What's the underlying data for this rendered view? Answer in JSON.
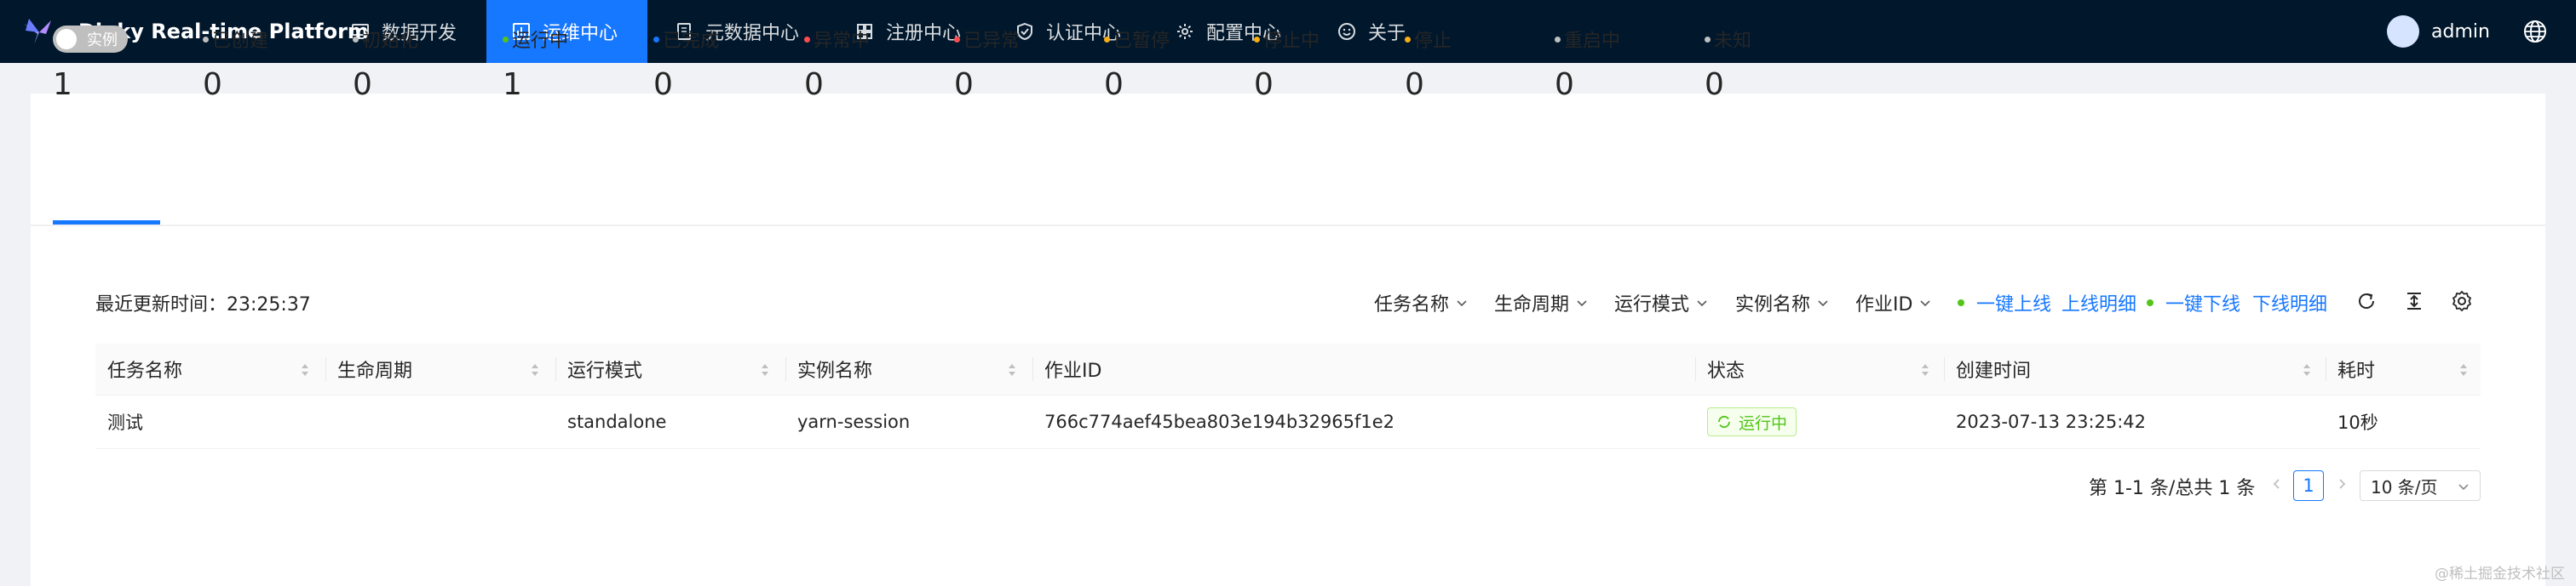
{
  "app": {
    "title": "Dinky Real-time Platform",
    "nav": [
      {
        "label": "数据开发",
        "icon": "monitor-icon"
      },
      {
        "label": "运维中心",
        "icon": "dashboard-icon",
        "active": true
      },
      {
        "label": "元数据中心",
        "icon": "book-icon"
      },
      {
        "label": "注册中心",
        "icon": "grid-icon"
      },
      {
        "label": "认证中心",
        "icon": "shield-icon"
      },
      {
        "label": "配置中心",
        "icon": "gear-icon"
      },
      {
        "label": "关于",
        "icon": "smile-icon"
      }
    ],
    "user": "admin"
  },
  "status": {
    "toggle_label": "实例",
    "first_value": "1",
    "items": [
      {
        "label": "已创建",
        "value": "0",
        "color": "#bfbfbf"
      },
      {
        "label": "初始化",
        "value": "0",
        "color": "#bfbfbf"
      },
      {
        "label": "运行中",
        "value": "1",
        "color": "#52c41a"
      },
      {
        "label": "已完成",
        "value": "0",
        "color": "#1677ff"
      },
      {
        "label": "异常中",
        "value": "0",
        "color": "#ff4d4f"
      },
      {
        "label": "已异常",
        "value": "0",
        "color": "#ff4d4f"
      },
      {
        "label": "已暂停",
        "value": "0",
        "color": "#faad14"
      },
      {
        "label": "停止中",
        "value": "0",
        "color": "#faad14"
      },
      {
        "label": "停止",
        "value": "0",
        "color": "#faad14"
      },
      {
        "label": "重启中",
        "value": "0",
        "color": "#bfbfbf"
      },
      {
        "label": "未知",
        "value": "0",
        "color": "#bfbfbf"
      }
    ]
  },
  "toolbar": {
    "last_update": "最近更新时间：23:25:37",
    "filters": [
      "任务名称",
      "生命周期",
      "运行模式",
      "实例名称",
      "作业ID"
    ],
    "online_all": "一键上线",
    "online_detail": "上线明细",
    "offline_all": "一键下线",
    "offline_detail": "下线明细"
  },
  "table": {
    "columns": [
      "任务名称",
      "生命周期",
      "运行模式",
      "实例名称",
      "作业ID",
      "状态",
      "创建时间",
      "耗时"
    ],
    "rows": [
      {
        "name": "测试",
        "lifecycle": "",
        "mode": "standalone",
        "instance": "yarn-session",
        "job_id": "766c774aef45bea803e194b32965f1e2",
        "status": "运行中",
        "created": "2023-07-13 23:25:42",
        "duration": "10秒"
      }
    ]
  },
  "pagination": {
    "total": "第 1-1 条/总共 1 条",
    "current": "1",
    "page_size": "10 条/页"
  },
  "watermark": "@稀土掘金技术社区"
}
